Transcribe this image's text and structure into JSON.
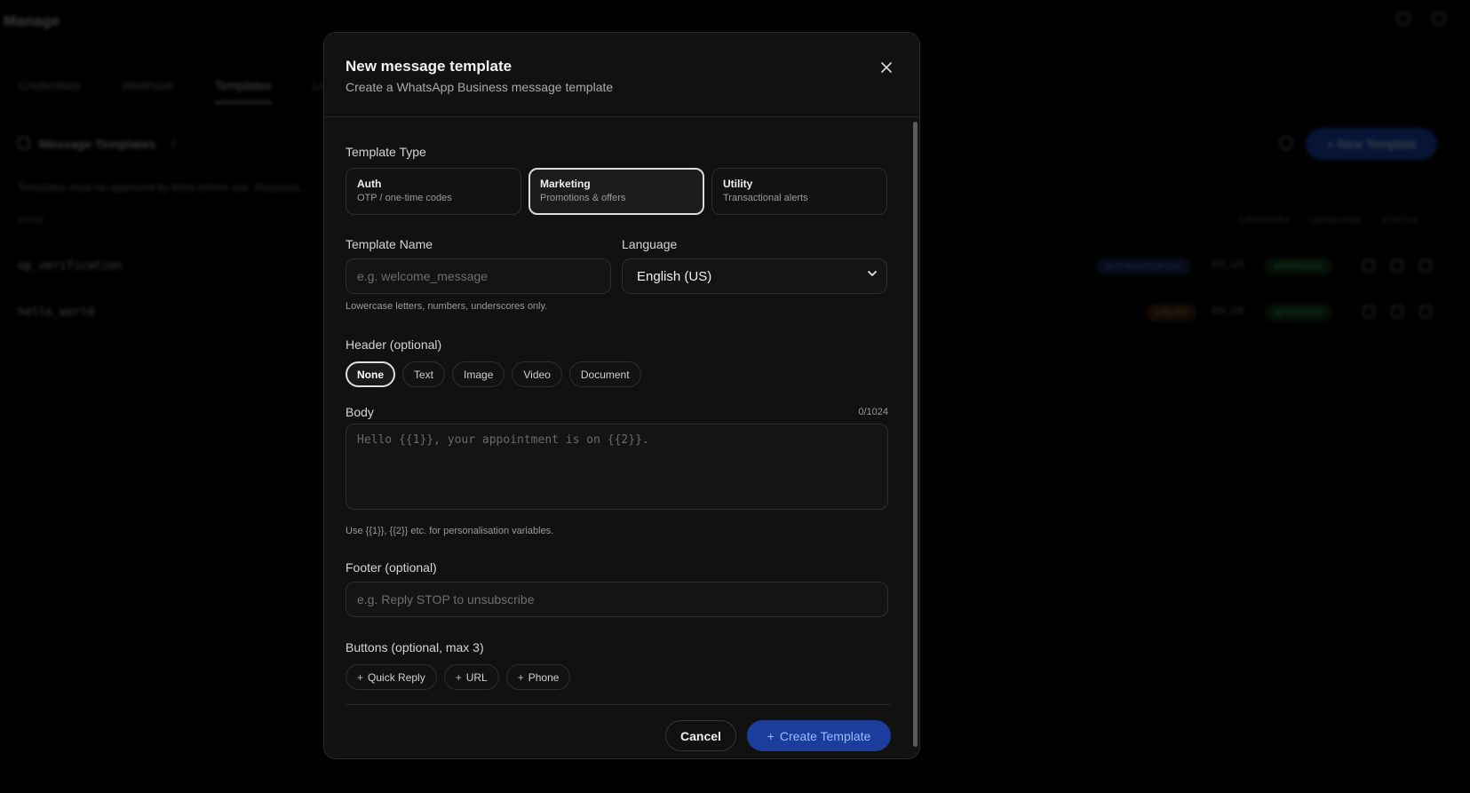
{
  "background": {
    "app_title": "Manage",
    "tabs": [
      "Credentials",
      "Webhook",
      "Templates",
      "Live"
    ],
    "section_title": "Message Templates",
    "section_count": "2",
    "new_template_label": "+ New Template",
    "note": "Templates must be approved by Meta before use. Requests...",
    "columns": [
      "NAME",
      "CATEGORY",
      "LANGUAGE",
      "STATUS"
    ],
    "rows": [
      {
        "name": "op_verification",
        "category": "AUTHENTICATION",
        "language": "EN_US",
        "status": "APPROVED"
      },
      {
        "name": "hello_world",
        "category": "UTILITY",
        "language": "EN_US",
        "status": "APPROVED"
      }
    ]
  },
  "modal": {
    "title": "New message template",
    "subtitle": "Create a WhatsApp Business message template",
    "template_type": {
      "label": "Template Type",
      "options": [
        {
          "title": "Auth",
          "desc": "OTP / one-time codes",
          "selected": false
        },
        {
          "title": "Marketing",
          "desc": "Promotions & offers",
          "selected": true
        },
        {
          "title": "Utility",
          "desc": "Transactional alerts",
          "selected": false
        }
      ]
    },
    "template_name": {
      "label": "Template Name",
      "placeholder": "e.g. welcome_message",
      "value": "",
      "hint": "Lowercase letters, numbers, underscores only."
    },
    "language": {
      "label": "Language",
      "value": "English (US)"
    },
    "header": {
      "label": "Header (optional)",
      "options": [
        "None",
        "Text",
        "Image",
        "Video",
        "Document"
      ],
      "selected": "None"
    },
    "body": {
      "label": "Body",
      "counter": "0/1024",
      "placeholder": "Hello {{1}}, your appointment is on {{2}}.",
      "hint": "Use {{1}}, {{2}} etc. for personalisation variables."
    },
    "footer": {
      "label": "Footer (optional)",
      "placeholder": "e.g. Reply STOP to unsubscribe"
    },
    "buttons": {
      "label": "Buttons (optional, max 3)",
      "options": [
        "Quick Reply",
        "URL",
        "Phone"
      ]
    },
    "actions": {
      "cancel": "Cancel",
      "create": "Create Template"
    }
  },
  "colors": {
    "accent": "#1c3d9c",
    "accent_text": "#9db9ff",
    "modal_bg": "#111111",
    "overlay": "#000000"
  }
}
